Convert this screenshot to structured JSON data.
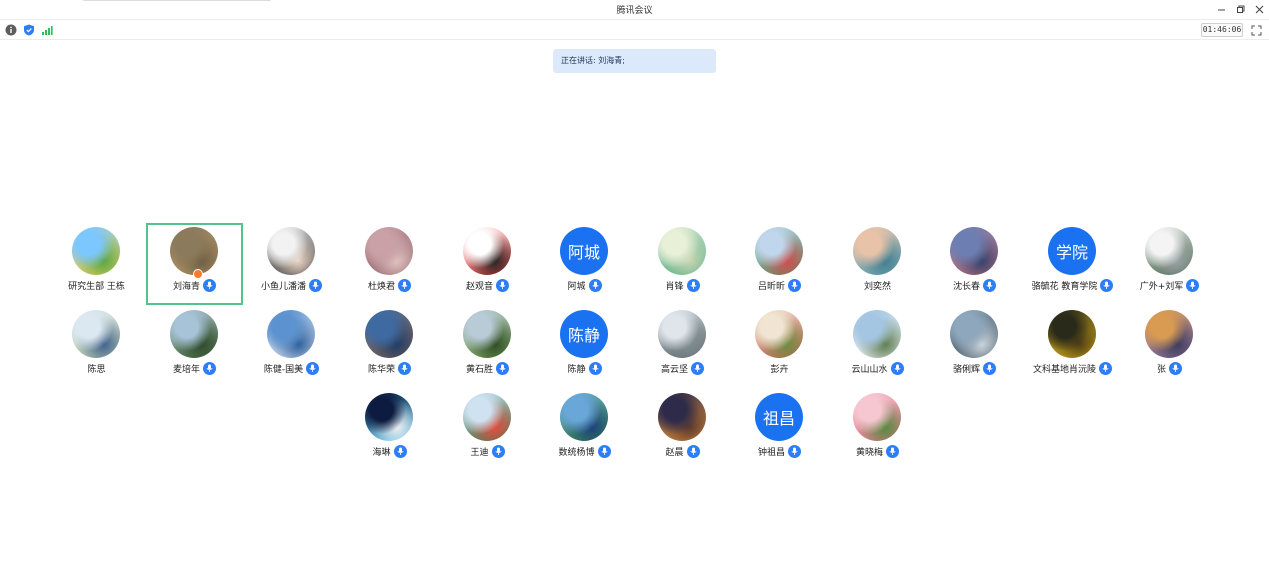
{
  "window": {
    "title": "腾讯会议"
  },
  "toolbar": {
    "timer": "01:46:06"
  },
  "speaking": {
    "label": "正在讲话: 刘海青;"
  },
  "participants": [
    {
      "name": "研究生部 王栋",
      "avatar": "photo",
      "mic": false,
      "colors": [
        "#7cc7ff",
        "#f5d23f",
        "#5aa542"
      ]
    },
    {
      "name": "刘海青",
      "avatar": "photo",
      "mic": true,
      "active": true,
      "colors": [
        "#8b7a5c",
        "#b89968",
        "#6f5e44"
      ]
    },
    {
      "name": "小鱼儿潘潘",
      "avatar": "photo",
      "mic": true,
      "colors": [
        "#f2f2f2",
        "#1b1b1b",
        "#e9d3c3"
      ]
    },
    {
      "name": "杜焕君",
      "avatar": "photo",
      "mic": true,
      "colors": [
        "#c9a1a6",
        "#8a5a63",
        "#e2c3c1"
      ]
    },
    {
      "name": "赵观音",
      "avatar": "photo",
      "mic": true,
      "colors": [
        "#ffffff",
        "#d72a2a",
        "#222222"
      ]
    },
    {
      "name": "阿城",
      "avatar": "text",
      "text": "阿城",
      "mic": true
    },
    {
      "name": "肖锋",
      "avatar": "photo",
      "mic": true,
      "colors": [
        "#e9f0d8",
        "#3ba37a",
        "#c7d4b1"
      ]
    },
    {
      "name": "吕昕昕",
      "avatar": "photo",
      "mic": true,
      "colors": [
        "#c0d6ec",
        "#4c8a57",
        "#d24b4b"
      ]
    },
    {
      "name": "刘奕然",
      "avatar": "photo",
      "mic": false,
      "colors": [
        "#e9c3a9",
        "#6fa6b6",
        "#3f7e8f"
      ]
    },
    {
      "name": "沈长春",
      "avatar": "photo",
      "mic": true,
      "colors": [
        "#6d7fb2",
        "#c86f77",
        "#33406b"
      ]
    },
    {
      "name": "骆毓花 教育学院",
      "avatar": "text",
      "text": "学院",
      "mic": true
    },
    {
      "name": "广外+刘军",
      "avatar": "photo",
      "mic": true,
      "colors": [
        "#f4f4f4",
        "#355a3a",
        "#9aa0a4"
      ]
    },
    {
      "name": "陈思",
      "avatar": "photo",
      "mic": false,
      "colors": [
        "#dbe8f2",
        "#b8c7a3",
        "#3c5e8a"
      ]
    },
    {
      "name": "麦培年",
      "avatar": "photo",
      "mic": true,
      "colors": [
        "#a7c3d8",
        "#4a6b3a",
        "#2e4a2b"
      ]
    },
    {
      "name": "陈健-国美",
      "avatar": "photo",
      "mic": true,
      "colors": [
        "#5c92cf",
        "#e9eef5",
        "#2c5d99"
      ]
    },
    {
      "name": "陈华荣",
      "avatar": "photo",
      "mic": true,
      "colors": [
        "#3f6aa1",
        "#8a6148",
        "#1e3c66"
      ]
    },
    {
      "name": "黄石胜",
      "avatar": "photo",
      "mic": true,
      "colors": [
        "#b8cbd7",
        "#6c9346",
        "#2d4b22"
      ]
    },
    {
      "name": "陈静",
      "avatar": "text",
      "text": "陈静",
      "mic": true
    },
    {
      "name": "高云坚",
      "avatar": "photo",
      "mic": true,
      "colors": [
        "#dfe5ea",
        "#4c5a60",
        "#7e8b8f"
      ]
    },
    {
      "name": "彭卉",
      "avatar": "photo",
      "mic": false,
      "colors": [
        "#f0e5d2",
        "#c7554a",
        "#6b8b3e"
      ]
    },
    {
      "name": "云山山水",
      "avatar": "photo",
      "mic": true,
      "colors": [
        "#a4c6e3",
        "#f4f4f4",
        "#5a7a4a"
      ]
    },
    {
      "name": "骆俐辉",
      "avatar": "photo",
      "mic": true,
      "colors": [
        "#8ea7bd",
        "#3a4b58",
        "#cfd8de"
      ]
    },
    {
      "name": "文科基地肖沅陵",
      "avatar": "photo",
      "mic": true,
      "colors": [
        "#2a2a1a",
        "#f2c61a",
        "#503e14"
      ]
    },
    {
      "name": "张",
      "avatar": "photo",
      "mic": true,
      "colors": [
        "#d99b52",
        "#7c6ba8",
        "#3d3a5a"
      ]
    },
    {
      "name": "海琳",
      "avatar": "photo",
      "mic": true,
      "colors": [
        "#0c1b3f",
        "#5cc9f5",
        "#f4f4f4"
      ]
    },
    {
      "name": "王迪",
      "avatar": "photo",
      "mic": true,
      "colors": [
        "#cfe2f2",
        "#2f6d3a",
        "#e44b3c"
      ]
    },
    {
      "name": "数统杨博",
      "avatar": "photo",
      "mic": true,
      "colors": [
        "#6aa7d9",
        "#2f7f3b",
        "#1b3f7a"
      ]
    },
    {
      "name": "赵晨",
      "avatar": "photo",
      "mic": true,
      "colors": [
        "#2d2a4a",
        "#f39a3a",
        "#5c3a2e"
      ]
    },
    {
      "name": "钟祖昌",
      "avatar": "text",
      "text": "祖昌",
      "mic": true
    },
    {
      "name": "黄晓梅",
      "avatar": "photo",
      "mic": true,
      "colors": [
        "#f6c7d0",
        "#e06a86",
        "#4f8a3a"
      ]
    }
  ]
}
